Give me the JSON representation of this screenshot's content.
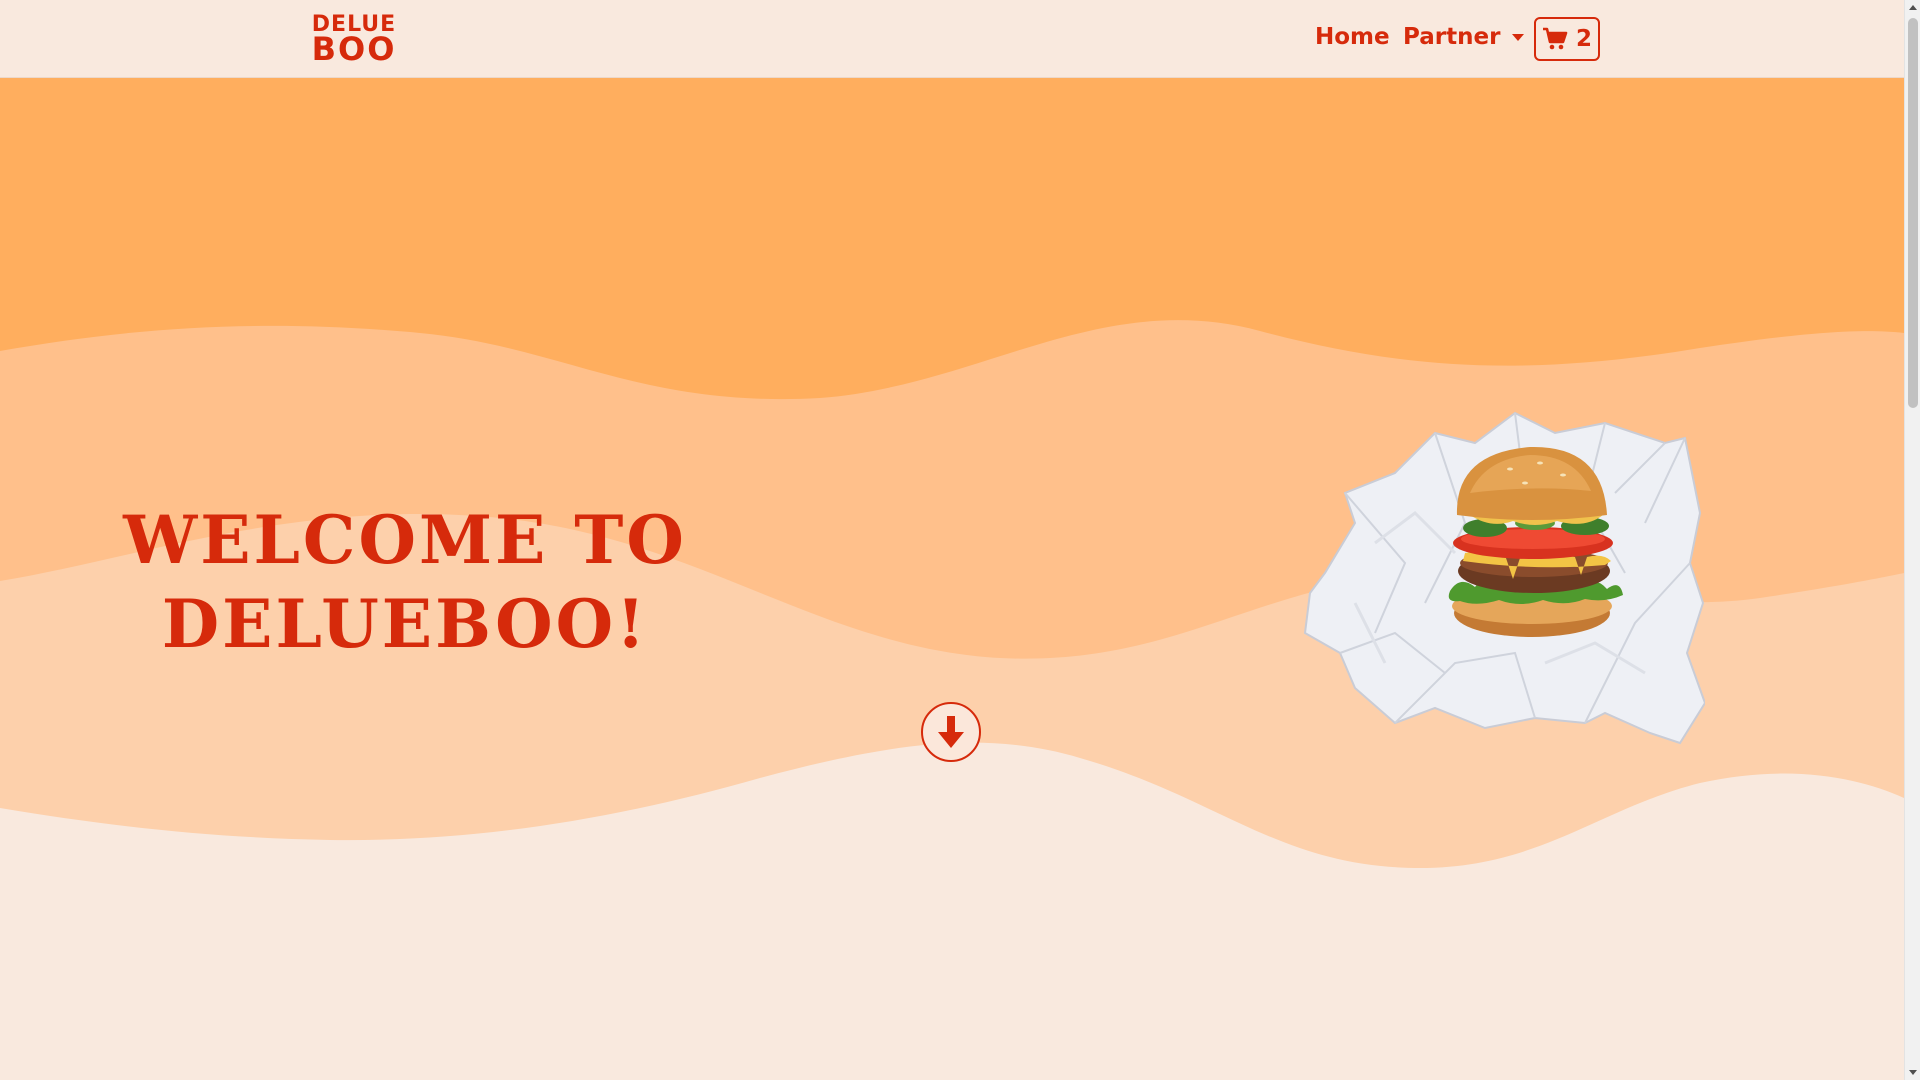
{
  "brand": {
    "logo_line1": "DELUE",
    "logo_line2": "BOO"
  },
  "nav": {
    "home_label": "Home",
    "partner_label": "Partner",
    "cart_count": "2",
    "cart_icon": "cart-icon",
    "caret_icon": "chevron-down-icon"
  },
  "hero": {
    "title_line1": "Welcome to",
    "title_line2": "Delueboo!",
    "scroll_icon": "arrow-down-icon",
    "image": "burger-image"
  },
  "colors": {
    "accent": "#d62a0b",
    "background": "#f9e9de",
    "wave_dark": "#ffae5e",
    "wave_mid": "#ffc08b",
    "wave_light": "#fdd0ab"
  }
}
